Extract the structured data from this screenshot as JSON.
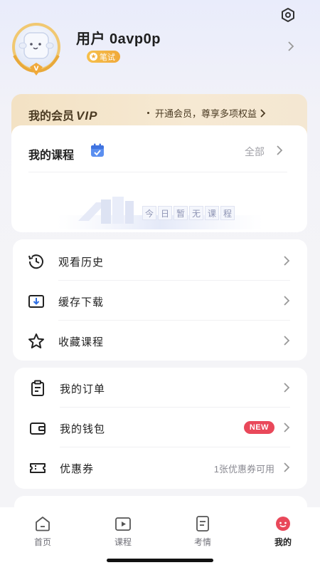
{
  "header": {
    "username": "用户 0avp0p",
    "badge": "笔试"
  },
  "vip": {
    "title_prefix": "我的会员",
    "title_vip": "VIP",
    "promo": "开通会员，尊享多项权益"
  },
  "courses": {
    "title": "我的课程",
    "all_label": "全部",
    "empty_chars": [
      "今",
      "日",
      "暂",
      "无",
      "课",
      "程"
    ]
  },
  "menu1": [
    {
      "label": "观看历史",
      "icon": "clock-history-icon"
    },
    {
      "label": "缓存下载",
      "icon": "download-icon"
    },
    {
      "label": "收藏课程",
      "icon": "star-icon"
    }
  ],
  "menu2": [
    {
      "label": "我的订单",
      "icon": "clipboard-icon"
    },
    {
      "label": "我的钱包",
      "icon": "wallet-icon",
      "badge": "NEW"
    },
    {
      "label": "优惠券",
      "icon": "ticket-icon",
      "note": "1张优惠券可用"
    }
  ],
  "tabs": [
    {
      "label": "首页",
      "icon": "home-icon"
    },
    {
      "label": "课程",
      "icon": "play-icon"
    },
    {
      "label": "考情",
      "icon": "document-icon"
    },
    {
      "label": "我的",
      "icon": "profile-icon",
      "active": true
    }
  ],
  "colors": {
    "accent_red": "#e9485a",
    "vip_gold": "#f3e2c4",
    "badge_orange": "#f0a93a"
  }
}
